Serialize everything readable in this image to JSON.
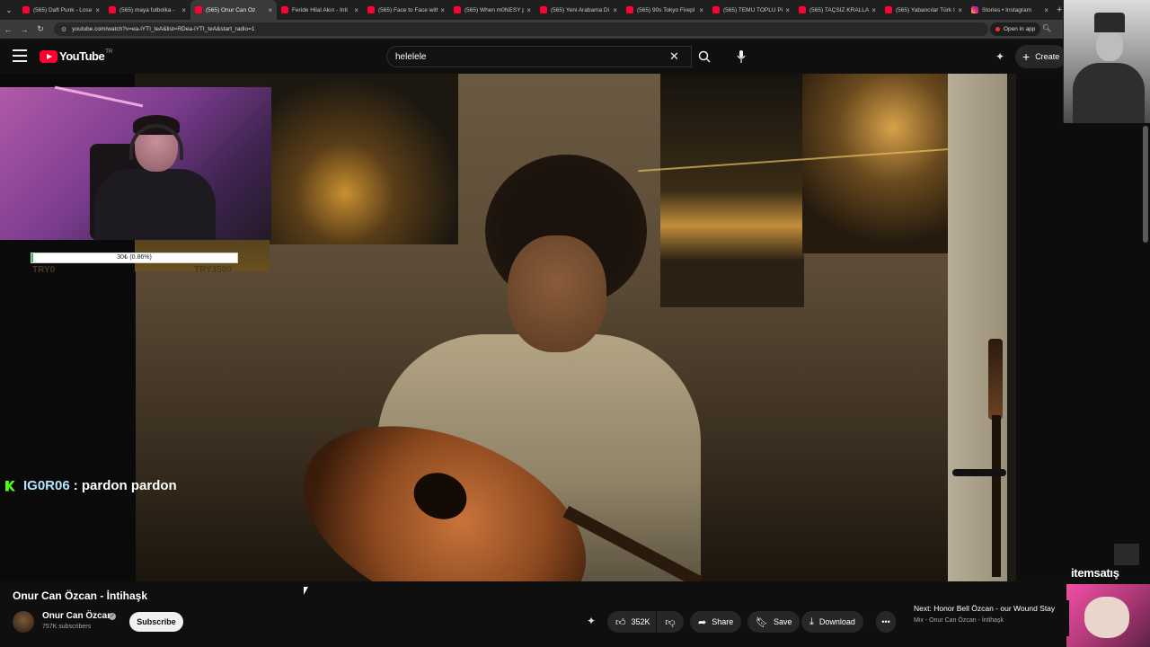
{
  "tabs": [
    {
      "label": "(565) Daft Punk - Lose",
      "active": false,
      "favicon": "youtube-icon"
    },
    {
      "label": "(565) maya futbolka -",
      "active": false,
      "favicon": "youtube-icon"
    },
    {
      "label": "(565) Onur Can Öz",
      "active": true,
      "favicon": "youtube-icon"
    },
    {
      "label": "Feride Hilal Akın - İnti",
      "active": false,
      "favicon": "youtube-icon"
    },
    {
      "label": "(565) Face to Face with",
      "active": false,
      "favicon": "youtube-icon"
    },
    {
      "label": "(565) When m0NESY p",
      "active": false,
      "favicon": "youtube-icon"
    },
    {
      "label": "(565) Yeni Arabama Di",
      "active": false,
      "favicon": "youtube-icon"
    },
    {
      "label": "(565) 90s Tokyo Firepl",
      "active": false,
      "favicon": "youtube-icon"
    },
    {
      "label": "(565) TEMU TOPLU Pi",
      "active": false,
      "favicon": "youtube-icon"
    },
    {
      "label": "(565) TAÇSIZ KRALLAR",
      "active": false,
      "favicon": "youtube-icon"
    },
    {
      "label": "(565) Yabancılar Türk I",
      "active": false,
      "favicon": "youtube-icon"
    },
    {
      "label": "Stories • Instagram",
      "active": false,
      "favicon": "instagram-icon"
    }
  ],
  "address": {
    "url": "youtube.com/watch?v=ea-iYTI_teA&list=RDea-iYTI_teA&start_radio=1",
    "open_in_app": "Open in app"
  },
  "header": {
    "logo_text": "YouTube",
    "region": "TR",
    "search_value": "helelele",
    "create_label": "Create"
  },
  "overlay": {
    "donation_text": "30₺ (0.86%)",
    "donation_progress_pct": 0.86,
    "donation_left": "TRY0",
    "donation_right": "TRY3500",
    "chat_user": "IG0R06",
    "chat_message": ": pardon pardon",
    "sponsor": "itemsatış"
  },
  "video_info": {
    "title": "Onur Can Özcan - İntihaşk",
    "channel": "Onur Can Özcan",
    "subscribers": "757K subscribers",
    "subscribe_label": "Subscribe",
    "likes": "352K",
    "share_label": "Share",
    "save_label": "Save",
    "download_label": "Download"
  },
  "next_up": {
    "title": "Next: Honor Bell Özcan - our Wound Stay",
    "subtitle": "Mix - Onur Can Özcan - İntihaşk"
  },
  "colors": {
    "youtube_red": "#ff0033",
    "kick_green": "#53fc18",
    "background": "#0f0f0f"
  }
}
